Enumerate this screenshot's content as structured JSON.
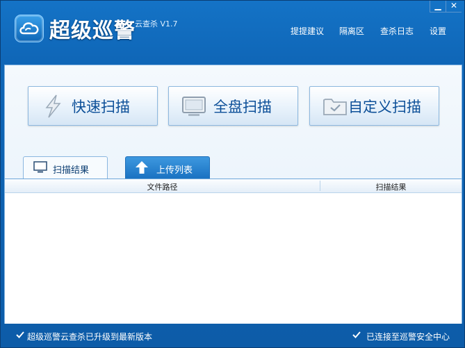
{
  "app": {
    "title": "超级巡警",
    "subtitle": "云查杀 V1.7"
  },
  "window": {
    "minimize_glyph": "▁",
    "close_glyph": "✕"
  },
  "topnav": {
    "feedback": "提提建议",
    "quarantine": "隔离区",
    "scan_log": "查杀日志",
    "settings": "设置"
  },
  "scan_buttons": {
    "quick": "快速扫描",
    "full": "全盘扫描",
    "custom": "自定义扫描"
  },
  "tabs": {
    "results": "扫描结果",
    "upload": "上传列表"
  },
  "table": {
    "columns": [
      "文件路径",
      "扫描结果"
    ],
    "rows": []
  },
  "status": {
    "left": "超级巡警云查杀已升级到最新版本",
    "right": "已连接至巡警安全中心"
  },
  "icons": {
    "logo": "cloud-logo-icon",
    "quick": "lightning-icon",
    "full": "monitor-icon",
    "custom": "folder-check-icon",
    "upload": "upload-arrow-icon",
    "status_ok": "check-icon"
  },
  "colors": {
    "titlebar": "#0f66b7",
    "accent_text": "#0c4f98",
    "tab_upload": "#1a72c2"
  }
}
